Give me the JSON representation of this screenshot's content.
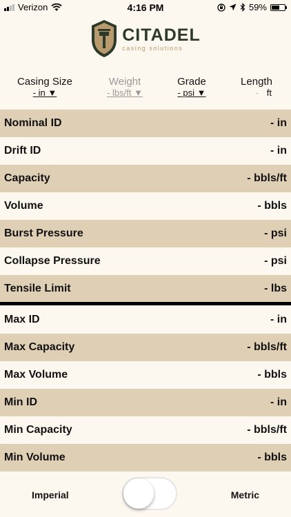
{
  "status_bar": {
    "carrier": "Verizon",
    "time": "4:16 PM",
    "battery": "59%",
    "battery_level": 0.59
  },
  "logo": {
    "name": "CITADEL",
    "tagline": "casing solutions"
  },
  "selectors": {
    "casing_size": {
      "title": "Casing Size",
      "value": "- in ▼"
    },
    "weight": {
      "title": "Weight",
      "value": "- lbs/ft ▼"
    },
    "grade": {
      "title": "Grade",
      "value": "- psi ▼"
    },
    "length": {
      "title": "Length",
      "value": "-",
      "unit": "ft"
    }
  },
  "rows": [
    {
      "label": "Nominal ID",
      "value": "- in"
    },
    {
      "label": "Drift ID",
      "value": "- in"
    },
    {
      "label": "Capacity",
      "value": "- bbls/ft"
    },
    {
      "label": "Volume",
      "value": "- bbls"
    },
    {
      "label": "Burst Pressure",
      "value": "- psi"
    },
    {
      "label": "Collapse Pressure",
      "value": "- psi"
    },
    {
      "label": "Tensile Limit",
      "value": "- lbs"
    },
    {
      "label": "Max ID",
      "value": "- in"
    },
    {
      "label": "Max Capacity",
      "value": "- bbls/ft"
    },
    {
      "label": "Max Volume",
      "value": "- bbls"
    },
    {
      "label": "Min ID",
      "value": "- in"
    },
    {
      "label": "Min Capacity",
      "value": "- bbls/ft"
    },
    {
      "label": "Min Volume",
      "value": "- bbls"
    }
  ],
  "units": {
    "left": "Imperial",
    "right": "Metric",
    "metric_enabled": false
  },
  "colors": {
    "background": "#fdf8ef",
    "row_shade": "#dfcfb5",
    "logo_dark": "#2d3a2a",
    "logo_gold": "#b79a6e"
  }
}
